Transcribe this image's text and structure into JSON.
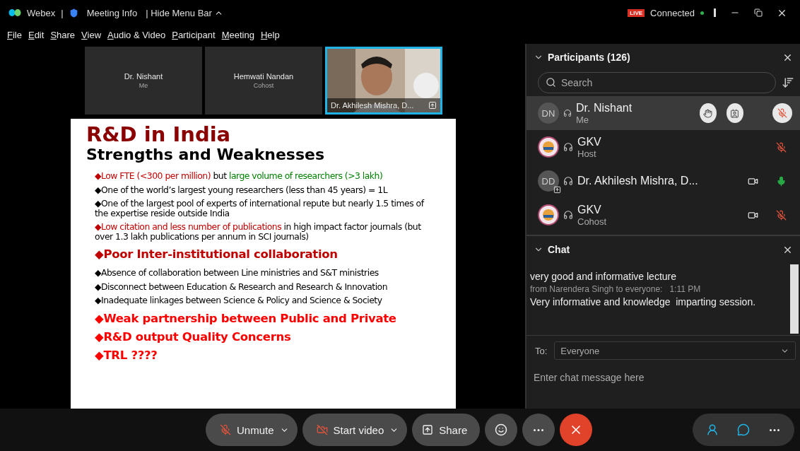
{
  "title_bar": {
    "app": "Webex",
    "separator": "|",
    "meeting_info": "Meeting Info",
    "hide_menu": "| Hide Menu Bar",
    "live_badge": "LIVE",
    "status": "Connected",
    "connected": true
  },
  "menu": [
    "File",
    "Edit",
    "Share",
    "View",
    "Audio & Video",
    "Participant",
    "Meeting",
    "Help"
  ],
  "video_strip": [
    {
      "kind": "tile",
      "name": "Dr. Nishant",
      "role": "Me",
      "selected": false
    },
    {
      "kind": "tile",
      "name": "Hemwati Nandan",
      "role": "Cohost",
      "selected": false
    },
    {
      "kind": "video",
      "name": "Dr. Akhilesh Mishra, D...",
      "selected": true,
      "sharing": true
    }
  ],
  "slide": {
    "title": "R&D in India",
    "subtitle": "Strengths and Weaknesses",
    "lines": [
      {
        "kind": "point",
        "segments": [
          {
            "text": "◆Low FTE (<300 per million)",
            "color": "#c00000"
          },
          {
            "text": " but ",
            "color": "#000000"
          },
          {
            "text": "large volume of researchers (>3 lakh)",
            "color": "#008000"
          }
        ]
      },
      {
        "kind": "point",
        "segments": [
          {
            "text": "◆One of the world’s largest young researchers (less than 45 years) = 1L",
            "color": "#000000"
          }
        ]
      },
      {
        "kind": "point",
        "segments": [
          {
            "text": "◆One of the largest pool of experts of international repute but nearly 1.5 times of the expertise reside outside India",
            "color": "#000000"
          }
        ]
      },
      {
        "kind": "point",
        "segments": [
          {
            "text": "◆Low citation and less number of publications",
            "color": "#c00000"
          },
          {
            "text": " in high impact factor journals (but over 1.3 lakh publications per annum in SCI journals)",
            "color": "#000000"
          }
        ]
      },
      {
        "kind": "heading",
        "segments": [
          {
            "text": "◆Poor Inter-institutional collaboration",
            "color": "#c00000"
          }
        ]
      },
      {
        "kind": "point",
        "segments": [
          {
            "text": "◆Absence of collaboration between Line ministries and S&T ministries",
            "color": "#000000"
          }
        ]
      },
      {
        "kind": "point",
        "segments": [
          {
            "text": "◆Disconnect between Education & Research and Research & Innovation",
            "color": "#000000"
          }
        ]
      },
      {
        "kind": "point",
        "segments": [
          {
            "text": "◆Inadequate linkages between Science & Policy and Science & Society",
            "color": "#000000"
          }
        ]
      },
      {
        "kind": "heading",
        "segments": [
          {
            "text": "◆Weak partnership between Public and Private",
            "color": "#ff0000"
          }
        ]
      },
      {
        "kind": "heading",
        "segments": [
          {
            "text": "◆R&D output Quality Concerns",
            "color": "#ff0000"
          }
        ]
      },
      {
        "kind": "heading",
        "segments": [
          {
            "text": "◆TRL ????",
            "color": "#ff0000"
          }
        ]
      }
    ]
  },
  "participants": {
    "title": "Participants (126)",
    "expanded": true,
    "search_placeholder": "Search",
    "items": [
      {
        "name": "Dr. Nishant",
        "role": "Me",
        "kind": "initials",
        "initials": "DN",
        "selected": true,
        "muted": true,
        "video": false,
        "sharing": false
      },
      {
        "name": "GKV",
        "role": "Host",
        "kind": "logo",
        "selected": false,
        "muted": true,
        "video": false,
        "sharing": false
      },
      {
        "name": "Dr. Akhilesh Mishra, D...",
        "kind": "initials",
        "initials": "DD",
        "selected": false,
        "muted": false,
        "video": true,
        "sharing": true
      },
      {
        "name": "GKV",
        "role": "Cohost",
        "kind": "logo",
        "selected": false,
        "muted": true,
        "video": true,
        "sharing": false
      }
    ]
  },
  "chat": {
    "title": "Chat",
    "expanded": true,
    "messages": [
      {
        "kind": "text",
        "text": "very good and informative lecture"
      },
      {
        "kind": "meta",
        "text": "from Narendera Singh to everyone:   1:11 PM"
      },
      {
        "kind": "text",
        "text": "Very informative and knowledge  imparting session."
      }
    ],
    "to_label": "To:",
    "recipient": "Everyone",
    "placeholder": "Enter chat message here"
  },
  "toolbar": {
    "unmute": "Unmute",
    "start_video": "Start video",
    "share": "Share",
    "muted": true,
    "video_on": false
  }
}
